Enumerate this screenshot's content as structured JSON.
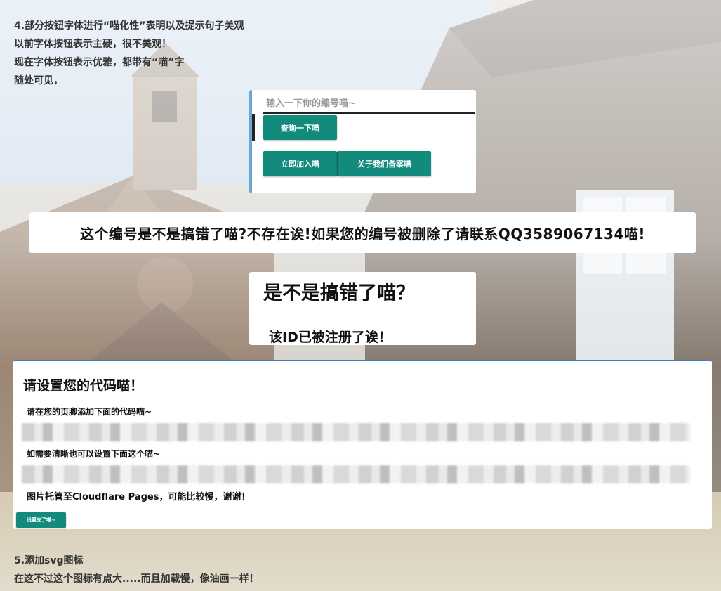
{
  "intro": {
    "lines": [
      "4.部分按钮字体进行“喵化性”表明以及提示句子美观",
      "以前字体按钮表示主硬，很不美观！",
      "现在字体按钮表示优雅，都带有“喵”字",
      "随处可见，"
    ]
  },
  "lookup": {
    "placeholder": "输入一下你的编号喵~",
    "query_button": "查询一下喵",
    "join_button": "立即加入喵",
    "about_button": "关于我们备案喵"
  },
  "banner": {
    "text": "这个编号是不是搞错了喵?不存在诶!如果您的编号被删除了请联系QQ3589067134喵!"
  },
  "mistake": {
    "title": "是不是搞错了喵？",
    "subtitle": "该ID已被注册了诶！"
  },
  "code_card": {
    "title": "请设置您的代码喵！",
    "label_footer": "请在您的页脚添加下面的代码喵~",
    "label_clear": "如需要清晰也可以设置下面这个喵~",
    "label_hosting": "图片托管至Cloudflare Pages，可能比较慢，谢谢！",
    "done_button": "设置完了喵~"
  },
  "outro": {
    "lines": [
      "5.添加svg图标",
      "在这不过这个图标有点大.....而且加载慢，像油画一样！"
    ]
  },
  "colors": {
    "button": "#138b7c",
    "card_accent": "#3d7fd0",
    "lookup_border": "#6aa9d6"
  }
}
